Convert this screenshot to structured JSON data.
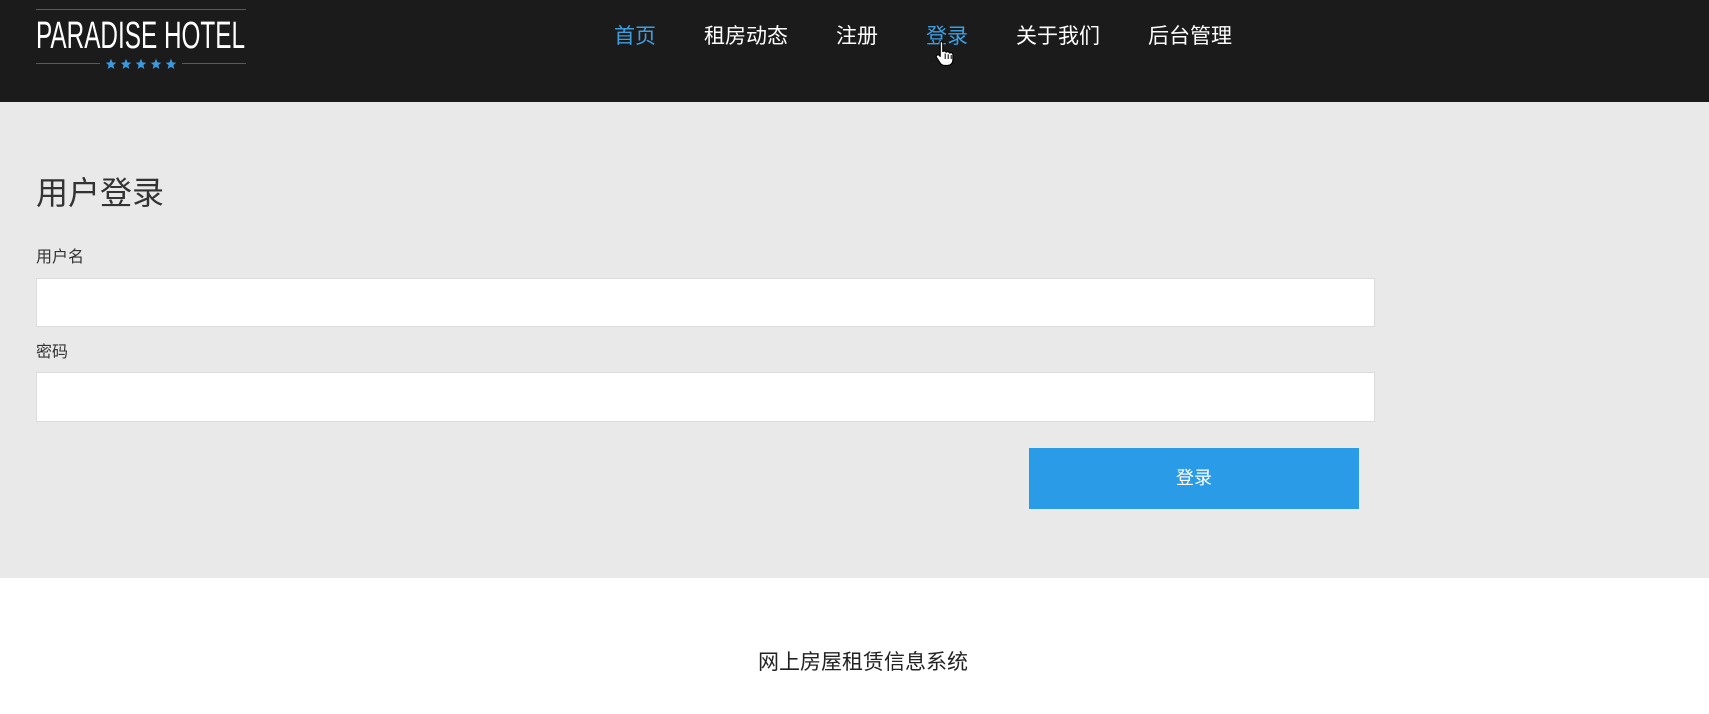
{
  "logo": {
    "text": "PARADISE HOTEL",
    "stars": 5
  },
  "nav": {
    "items": [
      {
        "label": "首页",
        "highlighted": true
      },
      {
        "label": "租房动态",
        "highlighted": false
      },
      {
        "label": "注册",
        "highlighted": false
      },
      {
        "label": "登录",
        "highlighted": true
      },
      {
        "label": "关于我们",
        "highlighted": false
      },
      {
        "label": "后台管理",
        "highlighted": false
      }
    ]
  },
  "login": {
    "title": "用户登录",
    "username_label": "用户名",
    "username_value": "",
    "password_label": "密码",
    "password_value": "",
    "submit_label": "登录"
  },
  "footer": {
    "text": "网上房屋租赁信息系统"
  },
  "icons": {
    "logo_star": "star-icon",
    "cursor": "hand-cursor-icon"
  },
  "colors": {
    "header_bg": "#1b1b1b",
    "nav_text": "#ffffff",
    "accent": "#3f9ee0",
    "star": "#3a9ae0",
    "main_bg": "#e9e9e9",
    "button_bg": "#2a9be6",
    "button_text": "#ffffff",
    "text": "#333333"
  }
}
